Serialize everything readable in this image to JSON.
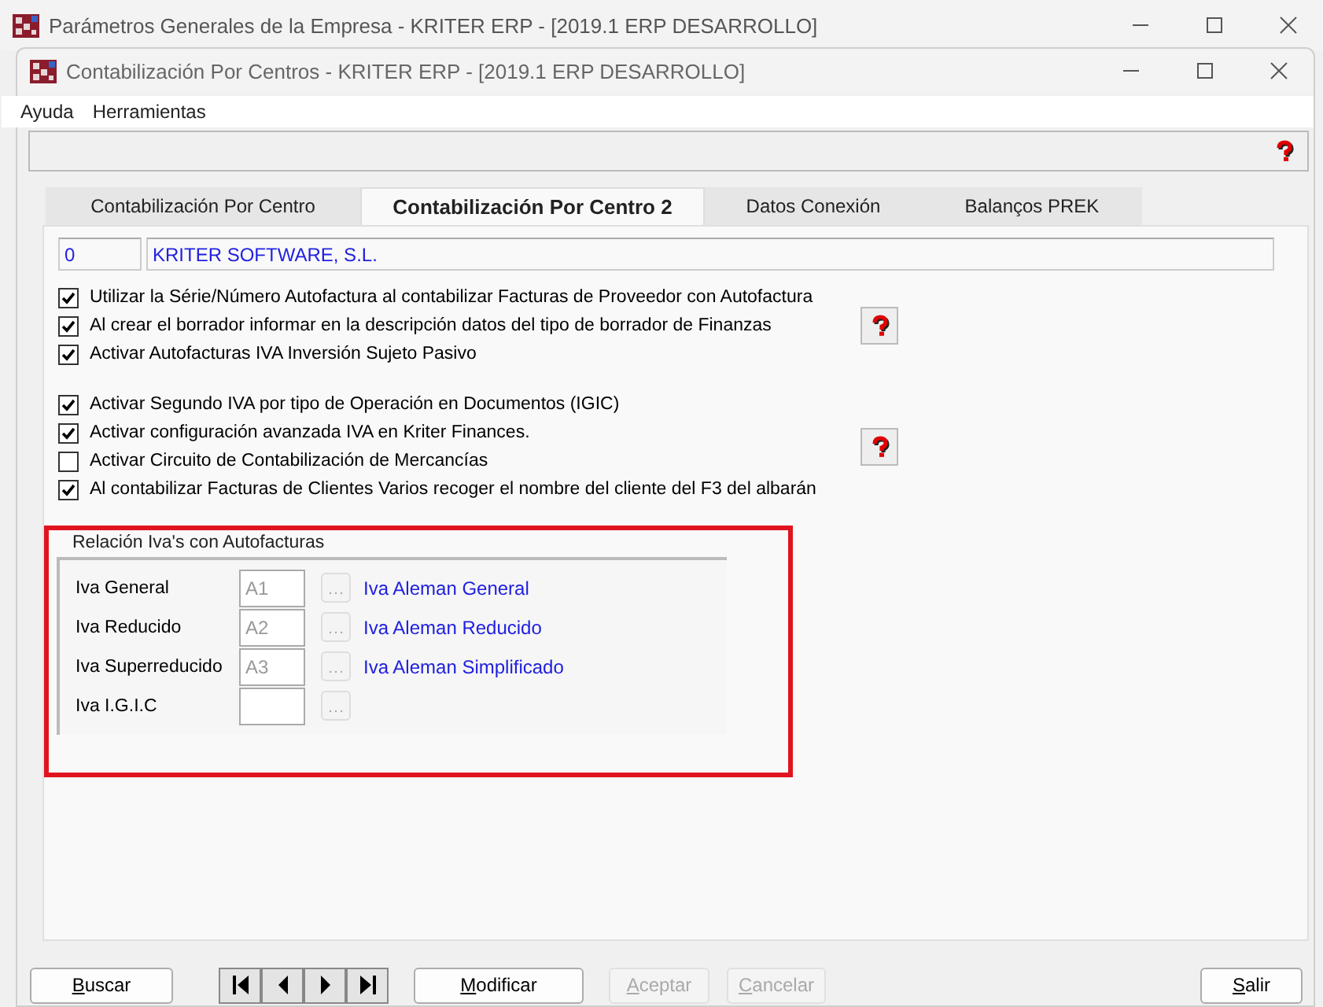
{
  "outer_window": {
    "title": "Parámetros Generales de la Empresa - KRITER ERP - [2019.1 ERP DESARROLLO]"
  },
  "window": {
    "title": "Contabilización Por Centros - KRITER ERP - [2019.1 ERP DESARROLLO]"
  },
  "menu": [
    "Ayuda",
    "Herramientas"
  ],
  "tabs": [
    {
      "label": "Contabilización Por Centro",
      "selected": false
    },
    {
      "label": "Contabilización Por Centro 2",
      "selected": true
    },
    {
      "label": "Datos Conexión",
      "selected": false
    },
    {
      "label": "Balanços PREK",
      "selected": false
    }
  ],
  "company": {
    "code": "0",
    "name": "KRITER SOFTWARE, S.L."
  },
  "option_groups": [
    {
      "options": [
        {
          "label": "Utilizar la Série/Número Autofactura al contabilizar Facturas de Proveedor con Autofactura",
          "checked": true
        },
        {
          "label": "Al crear el borrador informar en la descripción datos del tipo de borrador de Finanzas",
          "checked": true
        },
        {
          "label": "Activar Autofacturas IVA Inversión Sujeto Pasivo",
          "checked": true
        }
      ]
    },
    {
      "options": [
        {
          "label": "Activar Segundo IVA por tipo de Operación en Documentos (IGIC)",
          "checked": true
        },
        {
          "label": "Activar configuración avanzada IVA en Kriter Finances.",
          "checked": true
        },
        {
          "label": "Activar Circuito de Contabilización de Mercancías",
          "checked": false
        },
        {
          "label": "Al contabilizar Facturas de Clientes Varios recoger el nombre del cliente del F3 del albarán",
          "checked": true
        }
      ]
    }
  ],
  "iva_group": {
    "title": "Relación Iva's con Autofacturas",
    "rows": [
      {
        "label": "Iva General",
        "code": "A1",
        "description": "Iva Aleman General"
      },
      {
        "label": "Iva Reducido",
        "code": "A2",
        "description": "Iva Aleman Reducido"
      },
      {
        "label": "Iva Superreducido",
        "code": "A3",
        "description": "Iva Aleman Simplificado"
      },
      {
        "label": "Iva I.G.I.C"
      }
    ]
  },
  "buttons": [
    {
      "kind": "button",
      "label": "Buscar",
      "disabled": false
    },
    {
      "kind": "navigator"
    },
    {
      "kind": "button",
      "label": "Modificar",
      "disabled": false
    },
    {
      "kind": "button",
      "label": "Aceptar",
      "disabled": true
    },
    {
      "kind": "button",
      "label": "Cancelar",
      "disabled": true
    },
    {
      "kind": "spacer"
    },
    {
      "kind": "button",
      "label": "Salir",
      "disabled": false
    }
  ]
}
